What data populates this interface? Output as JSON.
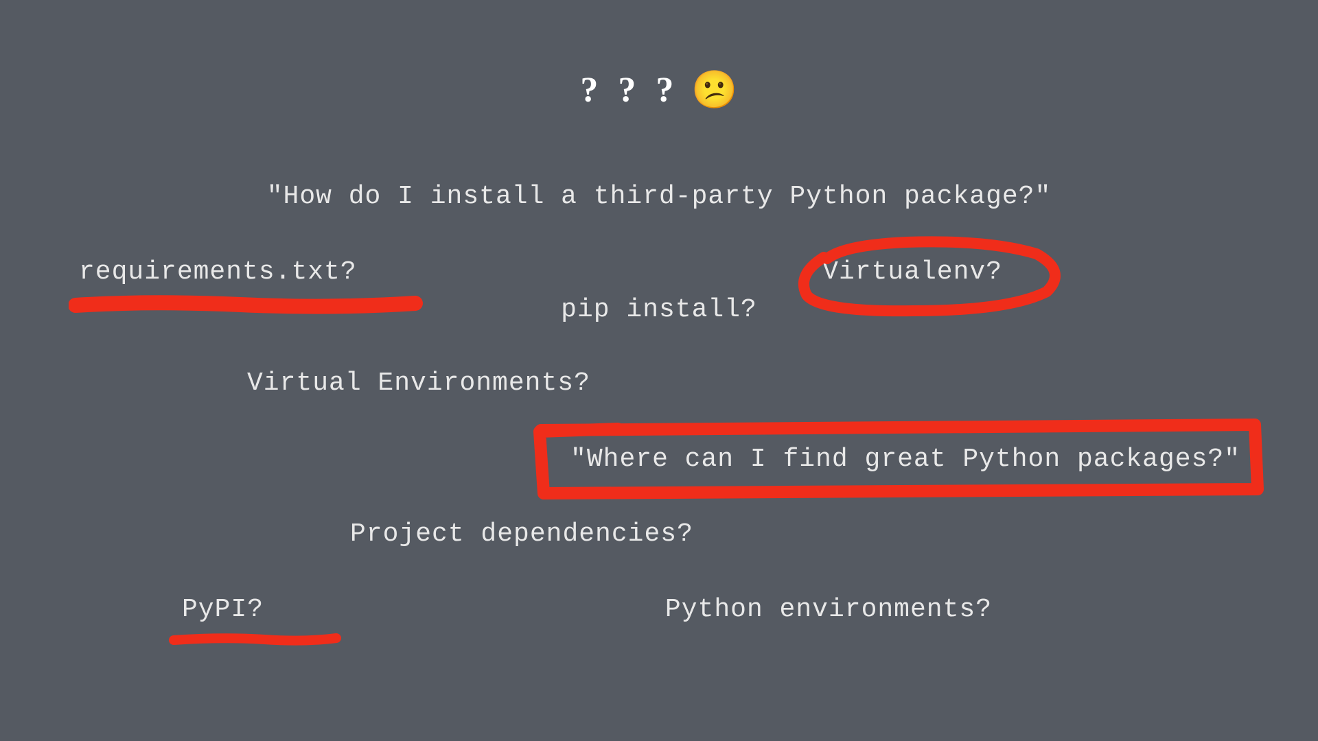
{
  "title": {
    "marks": "? ? ?",
    "emoji": "😕"
  },
  "terms": {
    "question1": "\"How do I install a third-party Python package?\"",
    "requirements": "requirements.txt?",
    "pip": "pip install?",
    "virtualenv": "Virtualenv?",
    "virtualEnvironments": "Virtual Environments?",
    "question2": "\"Where can I find great Python packages?\"",
    "dependencies": "Project dependencies?",
    "pypi": "PyPI?",
    "pythonEnvironments": "Python environments?"
  },
  "colors": {
    "background": "#555a62",
    "text": "#e8e8e8",
    "marker": "#f02d1a"
  }
}
